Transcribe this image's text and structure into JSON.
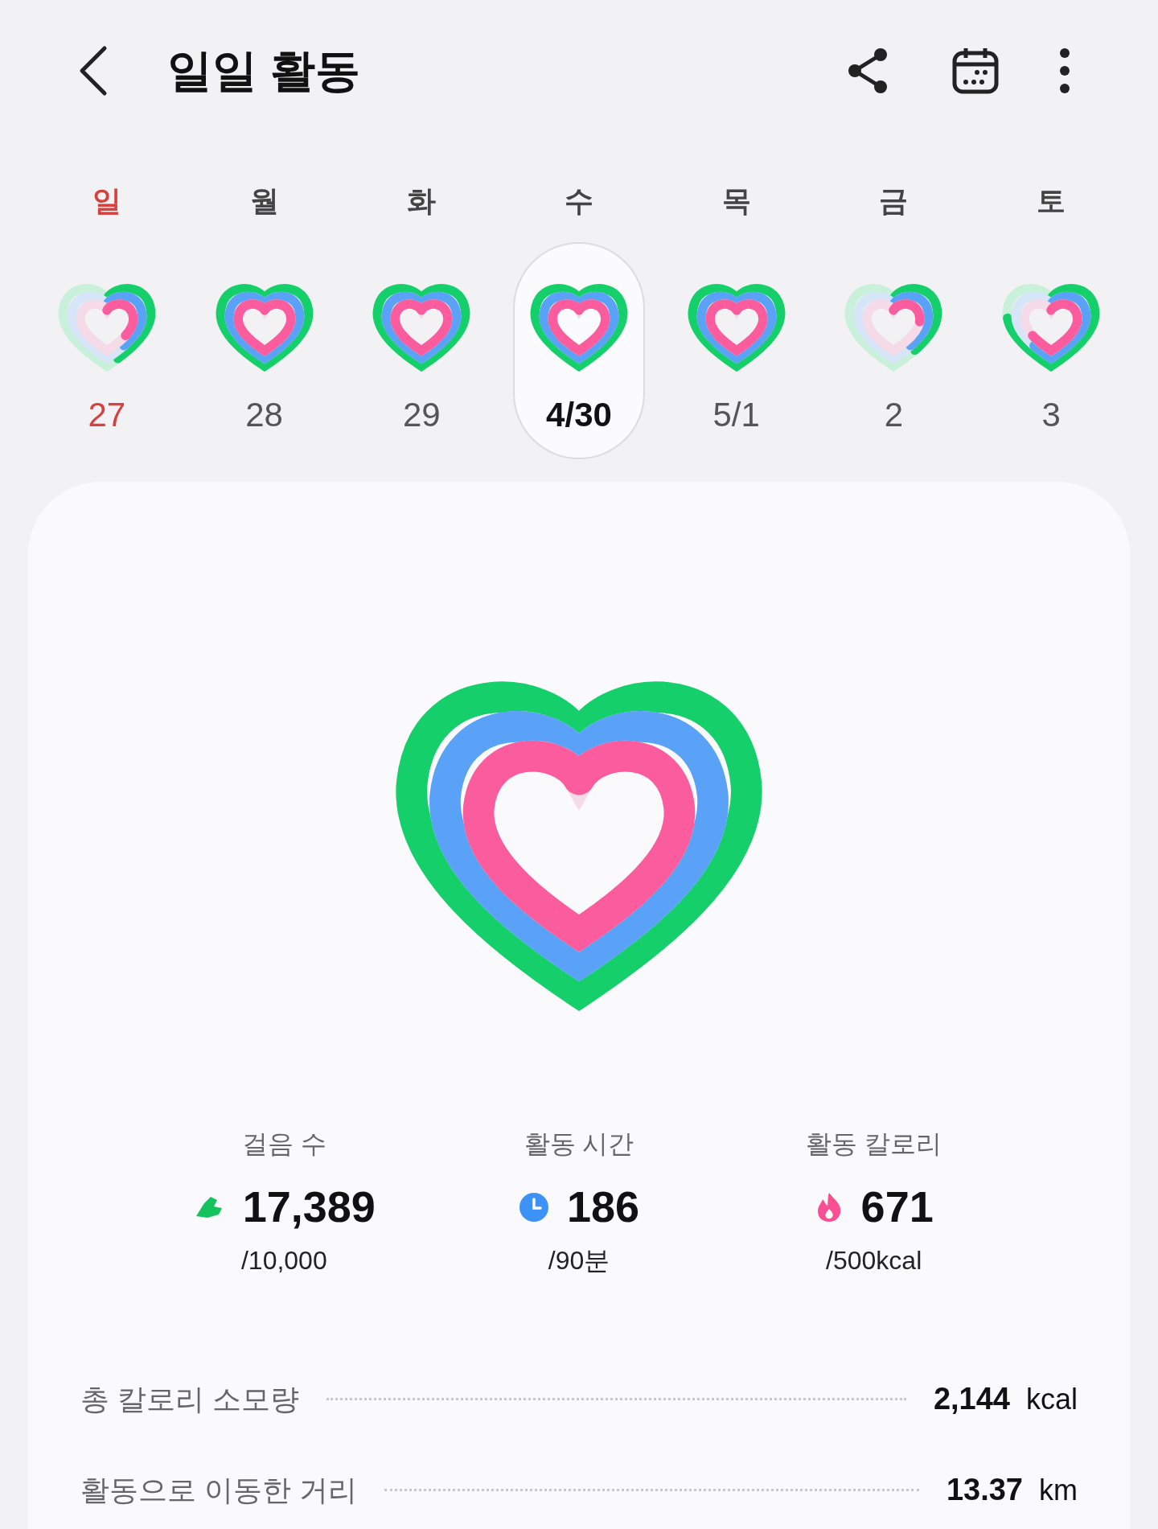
{
  "header": {
    "title": "일일 활동"
  },
  "days": [
    {
      "weekday": "일",
      "date": "27",
      "selected": false,
      "kind": "sunday"
    },
    {
      "weekday": "월",
      "date": "28",
      "selected": false,
      "kind": "weekday"
    },
    {
      "weekday": "화",
      "date": "29",
      "selected": false,
      "kind": "weekday"
    },
    {
      "weekday": "수",
      "date": "4/30",
      "selected": true,
      "kind": "weekday"
    },
    {
      "weekday": "목",
      "date": "5/1",
      "selected": false,
      "kind": "weekday"
    },
    {
      "weekday": "금",
      "date": "2",
      "selected": false,
      "kind": "weekday"
    },
    {
      "weekday": "토",
      "date": "3",
      "selected": false,
      "kind": "weekday"
    }
  ],
  "summary": {
    "stats": [
      {
        "kind": "steps",
        "label": "걸음 수",
        "value": "17,389",
        "goal": "/10,000"
      },
      {
        "kind": "time",
        "label": "활동 시간",
        "value": "186",
        "goal": "/90분"
      },
      {
        "kind": "calories",
        "label": "활동 칼로리",
        "value": "671",
        "goal": "/500kcal"
      }
    ],
    "details": [
      {
        "label": "총 칼로리 소모량",
        "value": "2,144",
        "unit": "kcal"
      },
      {
        "label": "활동으로 이동한 거리",
        "value": "13.37",
        "unit": "km"
      }
    ]
  }
}
